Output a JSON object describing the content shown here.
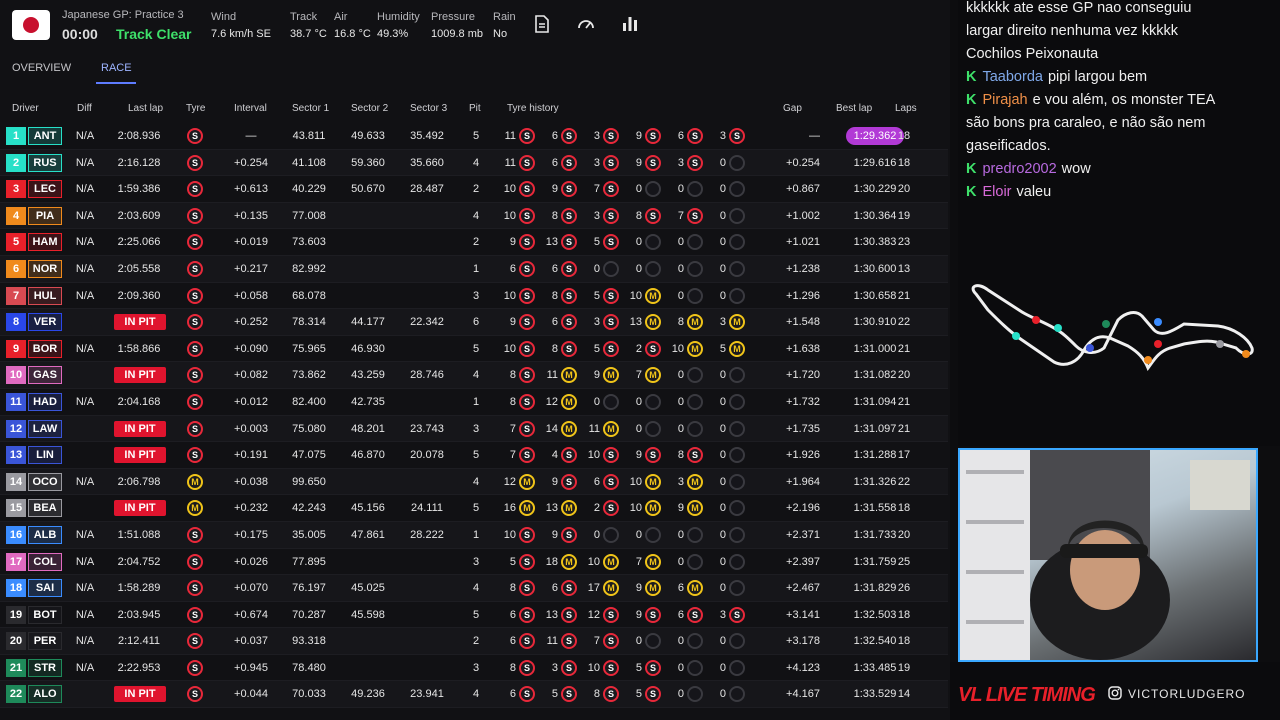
{
  "session": {
    "title": "Japanese GP: Practice 3",
    "clock": "00:00",
    "status": "Track Clear"
  },
  "weather": [
    {
      "label": "Wind",
      "value": "7.6 km/h SE"
    },
    {
      "label": "Track",
      "value": "38.7 °C"
    },
    {
      "label": "Air",
      "value": "16.8 °C"
    },
    {
      "label": "Humidity",
      "value": "49.3%"
    },
    {
      "label": "Pressure",
      "value": "1009.8 mb"
    },
    {
      "label": "Rain",
      "value": "No"
    }
  ],
  "tabs": [
    "OVERVIEW",
    "RACE"
  ],
  "columns": [
    "Driver",
    "Diff",
    "Last lap",
    "Tyre",
    "Interval",
    "Sector 1",
    "Sector 2",
    "Sector 3",
    "Pit",
    "Tyre history",
    "Gap",
    "Best lap",
    "Laps"
  ],
  "rows": [
    {
      "pos": "1",
      "code": "ANT",
      "color": "#27e0c8",
      "diff": "N/A",
      "last": "2:08.936",
      "tyre": "S",
      "interval": "—",
      "s1": "43.811",
      "s2": "49.633",
      "s3": "35.492",
      "pit": "5",
      "hist": [
        [
          "11",
          "S"
        ],
        [
          "6",
          "S"
        ],
        [
          "3",
          "S"
        ],
        [
          "9",
          "S"
        ],
        [
          "6",
          "S"
        ],
        [
          "3",
          "S"
        ]
      ],
      "gap": "—",
      "best": "1:29.362",
      "laps": "18"
    },
    {
      "pos": "2",
      "code": "RUS",
      "color": "#27e0c8",
      "diff": "N/A",
      "last": "2:16.128",
      "tyre": "S",
      "interval": "+0.254",
      "s1": "41.108",
      "s2": "59.360",
      "s3": "35.660",
      "pit": "4",
      "hist": [
        [
          "11",
          "S"
        ],
        [
          "6",
          "S"
        ],
        [
          "3",
          "S"
        ],
        [
          "9",
          "S"
        ],
        [
          "3",
          "S"
        ],
        [
          "0",
          "E"
        ]
      ],
      "gap": "+0.254",
      "best": "1:29.616",
      "laps": "18"
    },
    {
      "pos": "3",
      "code": "LEC",
      "color": "#e8202a",
      "diff": "N/A",
      "last": "1:59.386",
      "tyre": "S",
      "interval": "+0.613",
      "s1": "40.229",
      "s2": "50.670",
      "s3": "28.487",
      "pit": "2",
      "hist": [
        [
          "10",
          "S"
        ],
        [
          "9",
          "S"
        ],
        [
          "7",
          "S"
        ],
        [
          "0",
          "E"
        ],
        [
          "0",
          "E"
        ],
        [
          "0",
          "E"
        ]
      ],
      "gap": "+0.867",
      "best": "1:30.229",
      "laps": "20"
    },
    {
      "pos": "4",
      "code": "PIA",
      "color": "#f08a1c",
      "diff": "N/A",
      "last": "2:03.609",
      "tyre": "S",
      "interval": "+0.135",
      "s1": "77.008",
      "s2": "",
      "s3": "",
      "pit": "4",
      "hist": [
        [
          "10",
          "S"
        ],
        [
          "8",
          "S"
        ],
        [
          "3",
          "S"
        ],
        [
          "8",
          "S"
        ],
        [
          "7",
          "S"
        ],
        [
          "0",
          "E"
        ]
      ],
      "gap": "+1.002",
      "best": "1:30.364",
      "laps": "19"
    },
    {
      "pos": "5",
      "code": "HAM",
      "color": "#e8202a",
      "diff": "N/A",
      "last": "2:25.066",
      "tyre": "S",
      "interval": "+0.019",
      "s1": "73.603",
      "s2": "",
      "s3": "",
      "pit": "2",
      "hist": [
        [
          "9",
          "S"
        ],
        [
          "13",
          "S"
        ],
        [
          "5",
          "S"
        ],
        [
          "0",
          "E"
        ],
        [
          "0",
          "E"
        ],
        [
          "0",
          "E"
        ]
      ],
      "gap": "+1.021",
      "best": "1:30.383",
      "laps": "23"
    },
    {
      "pos": "6",
      "code": "NOR",
      "color": "#f08a1c",
      "diff": "N/A",
      "last": "2:05.558",
      "tyre": "S",
      "interval": "+0.217",
      "s1": "82.992",
      "s2": "",
      "s3": "",
      "pit": "1",
      "hist": [
        [
          "6",
          "S"
        ],
        [
          "6",
          "S"
        ],
        [
          "0",
          "E"
        ],
        [
          "0",
          "E"
        ],
        [
          "0",
          "E"
        ],
        [
          "0",
          "E"
        ]
      ],
      "gap": "+1.238",
      "best": "1:30.600",
      "laps": "13"
    },
    {
      "pos": "7",
      "code": "HUL",
      "color": "#d84a52",
      "diff": "N/A",
      "last": "2:09.360",
      "tyre": "S",
      "interval": "+0.058",
      "s1": "68.078",
      "s2": "",
      "s3": "",
      "pit": "3",
      "hist": [
        [
          "10",
          "S"
        ],
        [
          "8",
          "S"
        ],
        [
          "5",
          "S"
        ],
        [
          "10",
          "M"
        ],
        [
          "0",
          "E"
        ],
        [
          "0",
          "E"
        ]
      ],
      "gap": "+1.296",
      "best": "1:30.658",
      "laps": "21"
    },
    {
      "pos": "8",
      "code": "VER",
      "color": "#2a47e8",
      "diff": "IN PIT",
      "last": "",
      "tyre": "S",
      "interval": "+0.252",
      "s1": "78.314",
      "s2": "44.177",
      "s3": "22.342",
      "pit": "6",
      "hist": [
        [
          "9",
          "S"
        ],
        [
          "6",
          "S"
        ],
        [
          "3",
          "S"
        ],
        [
          "13",
          "M"
        ],
        [
          "8",
          "M"
        ],
        [
          "3",
          "M"
        ]
      ],
      "gap": "+1.548",
      "best": "1:30.910",
      "laps": "22"
    },
    {
      "pos": "9",
      "code": "BOR",
      "color": "#e8202a",
      "diff": "N/A",
      "last": "1:58.866",
      "tyre": "S",
      "interval": "+0.090",
      "s1": "75.965",
      "s2": "46.930",
      "s3": "",
      "pit": "5",
      "hist": [
        [
          "10",
          "S"
        ],
        [
          "8",
          "S"
        ],
        [
          "5",
          "S"
        ],
        [
          "2",
          "S"
        ],
        [
          "10",
          "M"
        ],
        [
          "5",
          "M"
        ]
      ],
      "gap": "+1.638",
      "best": "1:31.000",
      "laps": "21"
    },
    {
      "pos": "10",
      "code": "GAS",
      "color": "#e06ac0",
      "diff": "IN PIT",
      "last": "",
      "tyre": "S",
      "interval": "+0.082",
      "s1": "73.862",
      "s2": "43.259",
      "s3": "28.746",
      "pit": "4",
      "hist": [
        [
          "8",
          "S"
        ],
        [
          "11",
          "M"
        ],
        [
          "9",
          "M"
        ],
        [
          "7",
          "M"
        ],
        [
          "0",
          "E"
        ],
        [
          "0",
          "E"
        ]
      ],
      "gap": "+1.720",
      "best": "1:31.082",
      "laps": "20"
    },
    {
      "pos": "11",
      "code": "HAD",
      "color": "#3a55d8",
      "diff": "N/A",
      "last": "2:04.168",
      "tyre": "S",
      "interval": "+0.012",
      "s1": "82.400",
      "s2": "42.735",
      "s3": "",
      "pit": "1",
      "hist": [
        [
          "8",
          "S"
        ],
        [
          "12",
          "M"
        ],
        [
          "0",
          "E"
        ],
        [
          "0",
          "E"
        ],
        [
          "0",
          "E"
        ],
        [
          "0",
          "E"
        ]
      ],
      "gap": "+1.732",
      "best": "1:31.094",
      "laps": "21"
    },
    {
      "pos": "12",
      "code": "LAW",
      "color": "#3a55d8",
      "diff": "IN PIT",
      "last": "",
      "tyre": "S",
      "interval": "+0.003",
      "s1": "75.080",
      "s2": "48.201",
      "s3": "23.743",
      "pit": "3",
      "hist": [
        [
          "7",
          "S"
        ],
        [
          "14",
          "M"
        ],
        [
          "11",
          "M"
        ],
        [
          "0",
          "E"
        ],
        [
          "0",
          "E"
        ],
        [
          "0",
          "E"
        ]
      ],
      "gap": "+1.735",
      "best": "1:31.097",
      "laps": "21"
    },
    {
      "pos": "13",
      "code": "LIN",
      "color": "#3a55d8",
      "diff": "IN PIT",
      "last": "",
      "tyre": "S",
      "interval": "+0.191",
      "s1": "47.075",
      "s2": "46.870",
      "s3": "20.078",
      "pit": "5",
      "hist": [
        [
          "7",
          "S"
        ],
        [
          "4",
          "S"
        ],
        [
          "10",
          "S"
        ],
        [
          "9",
          "S"
        ],
        [
          "8",
          "S"
        ],
        [
          "0",
          "E"
        ]
      ],
      "gap": "+1.926",
      "best": "1:31.288",
      "laps": "17"
    },
    {
      "pos": "14",
      "code": "OCO",
      "color": "#9a9aa0",
      "diff": "N/A",
      "last": "2:06.798",
      "tyre": "M",
      "interval": "+0.038",
      "s1": "99.650",
      "s2": "",
      "s3": "",
      "pit": "4",
      "hist": [
        [
          "12",
          "M"
        ],
        [
          "9",
          "S"
        ],
        [
          "6",
          "S"
        ],
        [
          "10",
          "M"
        ],
        [
          "3",
          "M"
        ],
        [
          "0",
          "E"
        ]
      ],
      "gap": "+1.964",
      "best": "1:31.326",
      "laps": "22"
    },
    {
      "pos": "15",
      "code": "BEA",
      "color": "#9a9aa0",
      "diff": "IN PIT",
      "last": "",
      "tyre": "M",
      "interval": "+0.232",
      "s1": "42.243",
      "s2": "45.156",
      "s3": "24.111",
      "pit": "5",
      "hist": [
        [
          "16",
          "M"
        ],
        [
          "13",
          "M"
        ],
        [
          "2",
          "S"
        ],
        [
          "10",
          "M"
        ],
        [
          "9",
          "M"
        ],
        [
          "0",
          "E"
        ]
      ],
      "gap": "+2.196",
      "best": "1:31.558",
      "laps": "18"
    },
    {
      "pos": "16",
      "code": "ALB",
      "color": "#3a8cff",
      "diff": "N/A",
      "last": "1:51.088",
      "tyre": "S",
      "interval": "+0.175",
      "s1": "35.005",
      "s2": "47.861",
      "s3": "28.222",
      "pit": "1",
      "hist": [
        [
          "10",
          "S"
        ],
        [
          "9",
          "S"
        ],
        [
          "0",
          "E"
        ],
        [
          "0",
          "E"
        ],
        [
          "0",
          "E"
        ],
        [
          "0",
          "E"
        ]
      ],
      "gap": "+2.371",
      "best": "1:31.733",
      "laps": "20"
    },
    {
      "pos": "17",
      "code": "COL",
      "color": "#e06ac0",
      "diff": "N/A",
      "last": "2:04.752",
      "tyre": "S",
      "interval": "+0.026",
      "s1": "77.895",
      "s2": "",
      "s3": "",
      "pit": "3",
      "hist": [
        [
          "5",
          "S"
        ],
        [
          "18",
          "M"
        ],
        [
          "10",
          "M"
        ],
        [
          "7",
          "M"
        ],
        [
          "0",
          "E"
        ],
        [
          "0",
          "E"
        ]
      ],
      "gap": "+2.397",
      "best": "1:31.759",
      "laps": "25"
    },
    {
      "pos": "18",
      "code": "SAI",
      "color": "#3a8cff",
      "diff": "N/A",
      "last": "1:58.289",
      "tyre": "S",
      "interval": "+0.070",
      "s1": "76.197",
      "s2": "45.025",
      "s3": "",
      "pit": "4",
      "hist": [
        [
          "8",
          "S"
        ],
        [
          "6",
          "S"
        ],
        [
          "17",
          "M"
        ],
        [
          "9",
          "M"
        ],
        [
          "6",
          "M"
        ],
        [
          "0",
          "E"
        ]
      ],
      "gap": "+2.467",
      "best": "1:31.829",
      "laps": "26"
    },
    {
      "pos": "19",
      "code": "BOT",
      "color": "#2a2a2e",
      "diff": "N/A",
      "last": "2:03.945",
      "tyre": "S",
      "interval": "+0.674",
      "s1": "70.287",
      "s2": "45.598",
      "s3": "",
      "pit": "5",
      "hist": [
        [
          "6",
          "S"
        ],
        [
          "13",
          "S"
        ],
        [
          "12",
          "S"
        ],
        [
          "9",
          "S"
        ],
        [
          "6",
          "S"
        ],
        [
          "3",
          "S"
        ]
      ],
      "gap": "+3.141",
      "best": "1:32.503",
      "laps": "18"
    },
    {
      "pos": "20",
      "code": "PER",
      "color": "#2a2a2e",
      "diff": "N/A",
      "last": "2:12.411",
      "tyre": "S",
      "interval": "+0.037",
      "s1": "93.318",
      "s2": "",
      "s3": "",
      "pit": "2",
      "hist": [
        [
          "6",
          "S"
        ],
        [
          "11",
          "S"
        ],
        [
          "7",
          "S"
        ],
        [
          "0",
          "E"
        ],
        [
          "0",
          "E"
        ],
        [
          "0",
          "E"
        ]
      ],
      "gap": "+3.178",
      "best": "1:32.540",
      "laps": "18"
    },
    {
      "pos": "21",
      "code": "STR",
      "color": "#1e8a5a",
      "diff": "N/A",
      "last": "2:22.953",
      "tyre": "S",
      "interval": "+0.945",
      "s1": "78.480",
      "s2": "",
      "s3": "",
      "pit": "3",
      "hist": [
        [
          "8",
          "S"
        ],
        [
          "3",
          "S"
        ],
        [
          "10",
          "S"
        ],
        [
          "5",
          "S"
        ],
        [
          "0",
          "E"
        ],
        [
          "0",
          "E"
        ]
      ],
      "gap": "+4.123",
      "best": "1:33.485",
      "laps": "19"
    },
    {
      "pos": "22",
      "code": "ALO",
      "color": "#1e8a5a",
      "diff": "IN PIT",
      "last": "",
      "tyre": "S",
      "interval": "+0.044",
      "s1": "70.033",
      "s2": "49.236",
      "s3": "23.941",
      "pit": "4",
      "hist": [
        [
          "6",
          "S"
        ],
        [
          "5",
          "S"
        ],
        [
          "8",
          "S"
        ],
        [
          "5",
          "S"
        ],
        [
          "0",
          "E"
        ],
        [
          "0",
          "E"
        ]
      ],
      "gap": "+4.167",
      "best": "1:33.529",
      "laps": "14"
    }
  ],
  "chat": [
    {
      "user": "",
      "text": "kkkkkk ate esse GP nao conseguiu"
    },
    {
      "user": "",
      "text": "largar direito nenhuma vez kkkkk"
    },
    {
      "user": "",
      "text": "Cochilos Peixonauta"
    },
    {
      "user": "Taaborda",
      "color": "#7fa8e8",
      "text": "pipi largou bem"
    },
    {
      "user": "Pirajah",
      "color": "#f09048",
      "text": "e vou além, os monster TEA"
    },
    {
      "user": "",
      "text": "são bons pra caraleo, e não são nem"
    },
    {
      "user": "",
      "text": "gaseificados."
    },
    {
      "user": "predro2002",
      "color": "#b86ae0",
      "text": "wow"
    },
    {
      "user": "Eloir",
      "color": "#d86ad8",
      "text": "valeu"
    }
  ],
  "footer": {
    "brand": "VL LIVE TIMING",
    "handle": "VICTORLUDGERO"
  }
}
